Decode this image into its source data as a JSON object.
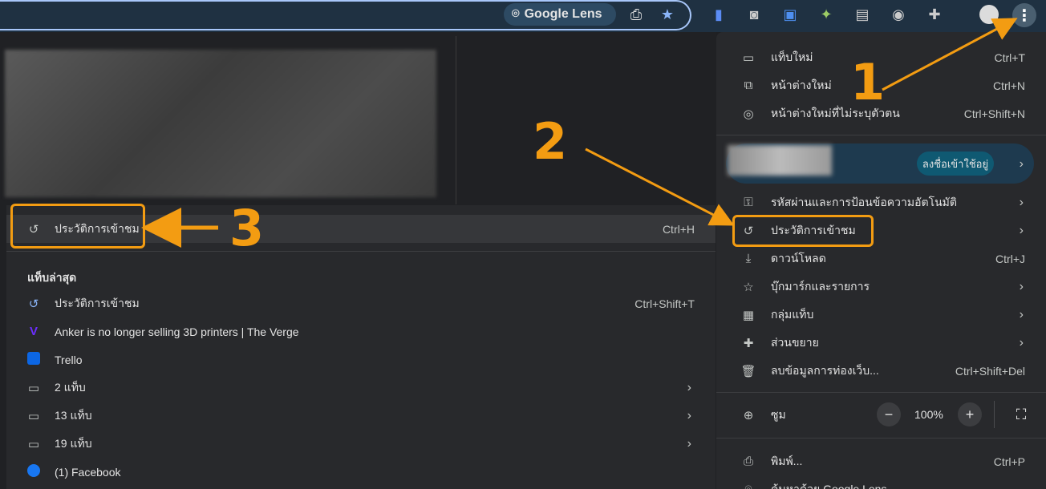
{
  "toolbar": {
    "lens_label": "Google Lens",
    "icons": [
      "lens-icon",
      "install-app-icon",
      "bookmark-star-icon",
      "extension-bookmark-icon",
      "camera-extension-icon",
      "translate-extension-icon",
      "bird-extension-icon",
      "window-extension-icon",
      "chat-extension-icon",
      "extensions-puzzle-icon",
      "profile-avatar",
      "menu-kebab-icon"
    ]
  },
  "main_menu": {
    "items": [
      {
        "label": "แท็บใหม่",
        "shortcut": "Ctrl+T",
        "icon": "new-tab-icon"
      },
      {
        "label": "หน้าต่างใหม่",
        "shortcut": "Ctrl+N",
        "icon": "new-window-icon"
      },
      {
        "label": "หน้าต่างใหม่ที่ไม่ระบุตัวตน",
        "shortcut": "Ctrl+Shift+N",
        "icon": "incognito-icon"
      }
    ],
    "profile": {
      "signin_label": "ลงชื่อเข้าใช้อยู่"
    },
    "items2": [
      {
        "label": "รหัสผ่านและการป้อนข้อความอัตโนมัติ",
        "icon": "key-icon"
      },
      {
        "label": "ประวัติการเข้าชม",
        "icon": "history-icon"
      },
      {
        "label": "ดาวน์โหลด",
        "shortcut": "Ctrl+J",
        "icon": "download-icon"
      },
      {
        "label": "บุ๊กมาร์กและรายการ",
        "icon": "star-icon"
      },
      {
        "label": "กลุ่มแท็บ",
        "icon": "tab-groups-icon"
      },
      {
        "label": "ส่วนขยาย",
        "icon": "puzzle-icon"
      },
      {
        "label": "ลบข้อมูลการท่องเว็บ...",
        "shortcut": "Ctrl+Shift+Del",
        "icon": "trash-icon"
      }
    ],
    "zoom": {
      "label": "ซูม",
      "value": "100%",
      "minus": "−",
      "plus": "+"
    },
    "items3": [
      {
        "label": "พิมพ์...",
        "shortcut": "Ctrl+P",
        "icon": "print-icon"
      },
      {
        "label": "ค้นหาด้วย Google Lens",
        "icon": "lens-icon"
      }
    ]
  },
  "history_menu": {
    "top": {
      "label": "ประวัติการเข้าชม",
      "shortcut": "Ctrl+H"
    },
    "recent_heading": "แท็บล่าสุด",
    "recent": [
      {
        "label": "ประวัติการเข้าชม",
        "shortcut": "Ctrl+Shift+T",
        "icon": "history-blue-icon"
      },
      {
        "label": "Anker is no longer selling 3D printers | The Verge",
        "icon": "verge-favicon"
      },
      {
        "label": "Trello",
        "icon": "trello-favicon"
      },
      {
        "label": "2 แท็บ",
        "icon": "window-icon"
      },
      {
        "label": "13 แท็บ",
        "icon": "window-icon"
      },
      {
        "label": "19 แท็บ",
        "icon": "window-icon"
      },
      {
        "label": "(1) Facebook",
        "icon": "facebook-favicon"
      }
    ]
  },
  "callouts": [
    "1",
    "2",
    "3"
  ],
  "colors": {
    "accent": "#f39c12",
    "menu_bg": "#28292c",
    "toolbar_bg": "#1f3142"
  }
}
